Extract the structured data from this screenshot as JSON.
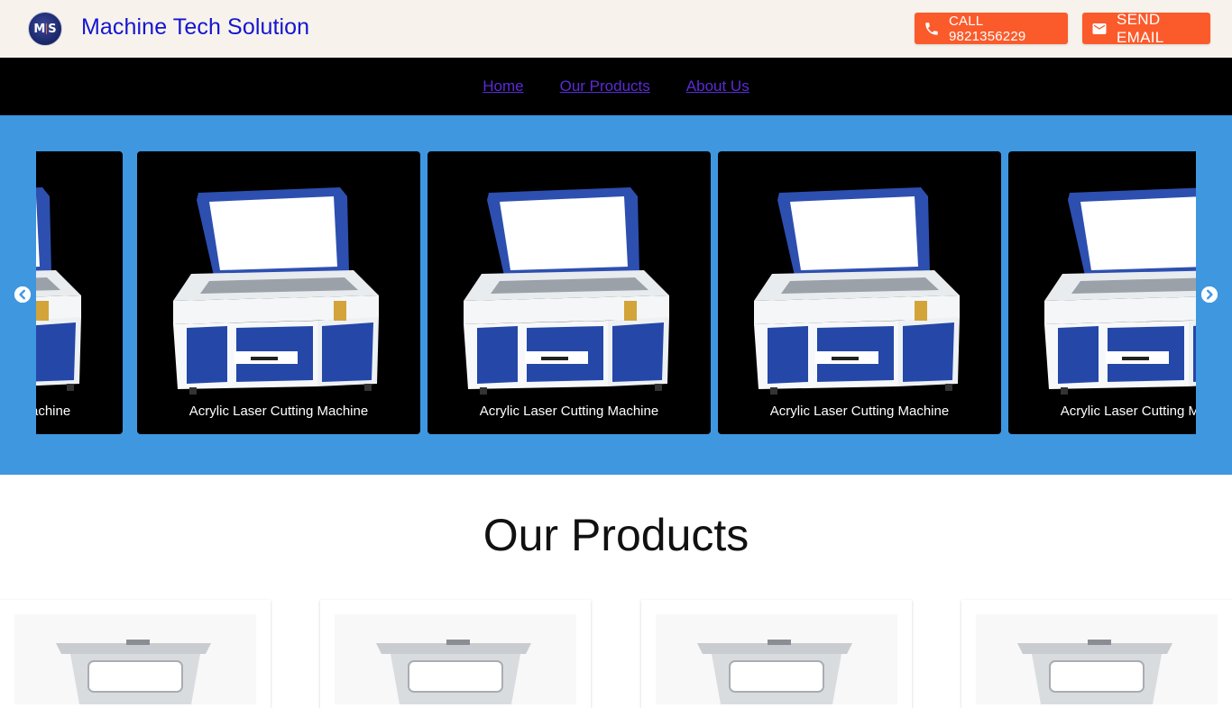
{
  "header": {
    "brand": "Machine Tech Solution",
    "logo_text": "MTS",
    "call_label": "CALL 9821356229",
    "email_label": "SEND EMAIL",
    "accent_color": "#fb5a2b",
    "brand_color": "#1515d0"
  },
  "nav": {
    "items": [
      {
        "label": "Home"
      },
      {
        "label": "Our Products"
      },
      {
        "label": "About Us"
      }
    ]
  },
  "carousel": {
    "background_color": "#3f97e0",
    "prev_icon": "chevron-left-circle-icon",
    "next_icon": "chevron-right-circle-icon",
    "cards": [
      {
        "label": "Acrylic Laser Cutting Machine"
      },
      {
        "label": "Acrylic Laser Cutting Machine"
      },
      {
        "label": "Acrylic Laser Cutting Machine"
      },
      {
        "label": "Acrylic Laser Cutting Machine"
      },
      {
        "label": "Acrylic Laser Cutting Machine"
      }
    ]
  },
  "products": {
    "title": "Our Products",
    "count_visible": 4
  }
}
